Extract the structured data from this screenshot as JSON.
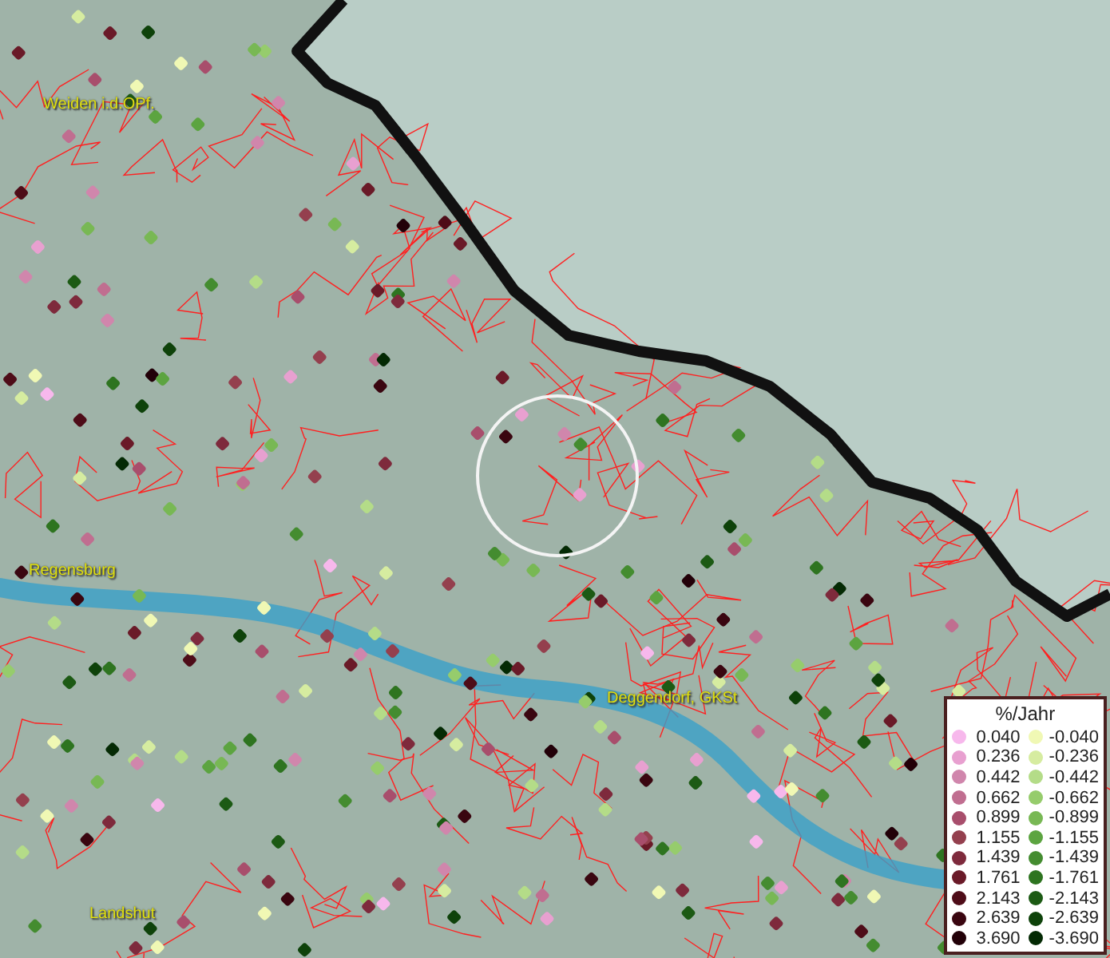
{
  "map": {
    "places": [
      {
        "name": "Weiden i.d.OPf."
      },
      {
        "name": "Regensburg"
      },
      {
        "name": "Deggendorf, GKSt"
      },
      {
        "name": "Landshut"
      }
    ]
  },
  "legend": {
    "title": "%/Jahr",
    "columns": [
      {
        "items": [
          {
            "label": "0.040",
            "color": "#f7b8ec"
          },
          {
            "label": "0.236",
            "color": "#e8a0d0"
          },
          {
            "label": "0.442",
            "color": "#d086ac"
          },
          {
            "label": "0.662",
            "color": "#c06e90"
          },
          {
            "label": "0.899",
            "color": "#a84e6c"
          },
          {
            "label": "1.155",
            "color": "#94404e"
          },
          {
            "label": "1.439",
            "color": "#7e2a3c"
          },
          {
            "label": "1.761",
            "color": "#6a1a28"
          },
          {
            "label": "2.143",
            "color": "#4e0c18"
          },
          {
            "label": "2.639",
            "color": "#3a0610"
          },
          {
            "label": "3.690",
            "color": "#220008"
          }
        ]
      },
      {
        "items": [
          {
            "label": "-0.040",
            "color": "#f0f8b4"
          },
          {
            "label": "-0.236",
            "color": "#d6eca0"
          },
          {
            "label": "-0.442",
            "color": "#b4dc88"
          },
          {
            "label": "-0.662",
            "color": "#96cc6c"
          },
          {
            "label": "-0.899",
            "color": "#78b854"
          },
          {
            "label": "-1.155",
            "color": "#5ca440"
          },
          {
            "label": "-1.439",
            "color": "#448c30"
          },
          {
            "label": "-1.761",
            "color": "#2e7420"
          },
          {
            "label": "-2.143",
            "color": "#1c5a14"
          },
          {
            "label": "-2.639",
            "color": "#0e420a"
          },
          {
            "label": "-3.690",
            "color": "#042a04"
          }
        ]
      }
    ]
  }
}
